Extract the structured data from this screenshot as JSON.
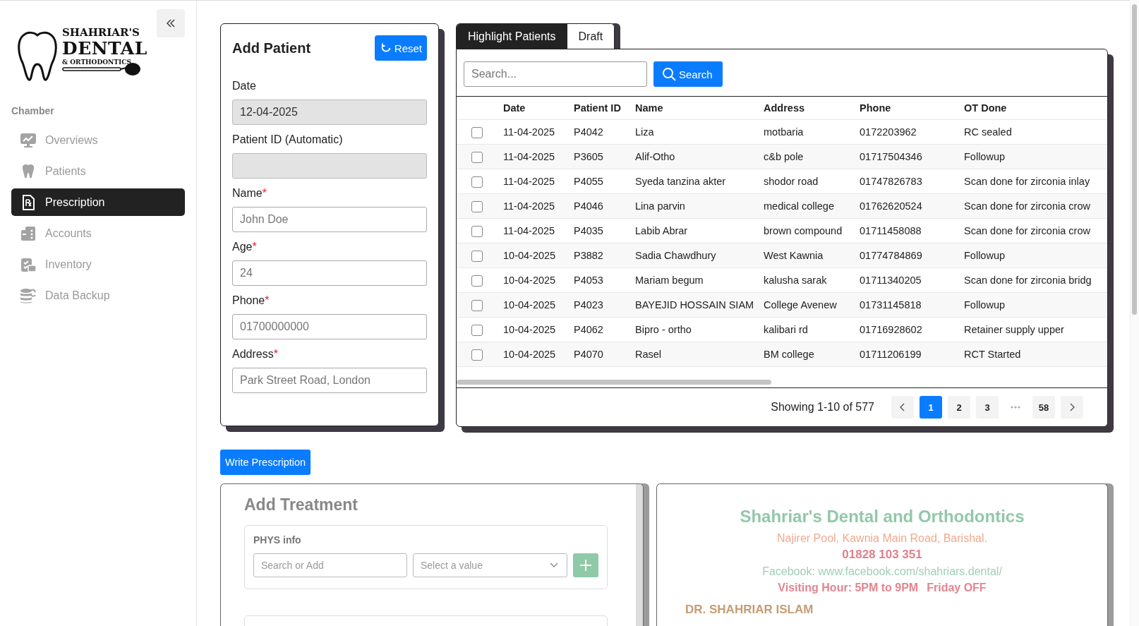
{
  "sidebar": {
    "logo": [
      "SHAHRIAR'S",
      "DENTAL",
      "& ORTHODONTICS"
    ],
    "section": "Chamber",
    "items": [
      {
        "label": "Overviews",
        "selected": false
      },
      {
        "label": "Patients",
        "selected": false
      },
      {
        "label": "Prescription",
        "selected": true
      },
      {
        "label": "Accounts",
        "selected": false
      },
      {
        "label": "Inventory",
        "selected": false
      },
      {
        "label": "Data Backup",
        "selected": false
      }
    ]
  },
  "add_patient": {
    "title": "Add Patient",
    "reset": "Reset",
    "fields": [
      {
        "label": "Date",
        "value": "12-04-2025",
        "disabled": true
      },
      {
        "label": "Patient ID (Automatic)",
        "disabled": true
      },
      {
        "label": "Name",
        "required_mark": "*",
        "placeholder": "John Doe",
        "disabled": false
      },
      {
        "label": "Age",
        "required_mark": "*",
        "placeholder": "24",
        "disabled": false
      },
      {
        "label": "Phone",
        "required_mark": "*",
        "placeholder": "01700000000",
        "disabled": false
      },
      {
        "label": "Address",
        "required_mark": "*",
        "placeholder": "Park Street Road, London",
        "disabled": false
      }
    ]
  },
  "tabs": [
    {
      "label": "Highlight Patients",
      "selected": true
    },
    {
      "label": "Draft",
      "selected": false
    }
  ],
  "search": {
    "placeholder": "Search...",
    "button": "Search"
  },
  "table": {
    "columns": [
      "Date",
      "Patient ID",
      "Name",
      "Address",
      "Phone",
      "OT Done"
    ],
    "rows": [
      {
        "checked": false,
        "cells": [
          "11-04-2025",
          "P4042",
          "Liza",
          "motbaria",
          "0172203962",
          "RC sealed"
        ]
      },
      {
        "checked": false,
        "cells": [
          "11-04-2025",
          "P3605",
          "Alif-Otho",
          "c&b pole",
          "01717504346",
          "Followup"
        ]
      },
      {
        "checked": false,
        "cells": [
          "11-04-2025",
          "P4055",
          "Syeda tanzina akter",
          "shodor road",
          "01747826783",
          "Scan done for zirconia inlay"
        ]
      },
      {
        "checked": false,
        "cells": [
          "11-04-2025",
          "P4046",
          "Lina parvin",
          "medical college",
          "01762620524",
          "Scan done for zirconia crow"
        ]
      },
      {
        "checked": false,
        "cells": [
          "11-04-2025",
          "P4035",
          "Labib Abrar",
          "brown compound",
          "01711458088",
          "Scan done for zirconia crow"
        ]
      },
      {
        "checked": false,
        "cells": [
          "10-04-2025",
          "P3882",
          "Sadia Chawdhury",
          "West Kawnia",
          "01774784869",
          "Followup"
        ]
      },
      {
        "checked": false,
        "cells": [
          "10-04-2025",
          "P4053",
          "Mariam begum",
          "kalusha sarak",
          "01711340205",
          "Scan done for zirconia bridg"
        ]
      },
      {
        "checked": false,
        "cells": [
          "10-04-2025",
          "P4023",
          "BAYEJID HOSSAIN SIAM",
          "College Avenew",
          "01731145818",
          "Followup"
        ]
      },
      {
        "checked": false,
        "cells": [
          "10-04-2025",
          "P4062",
          "Bipro - ortho",
          "kalibari rd",
          "01716928602",
          "Retainer supply upper"
        ]
      },
      {
        "checked": false,
        "cells": [
          "10-04-2025",
          "P4070",
          "Rasel",
          "BM college",
          "01711206199",
          "RCT Started"
        ]
      }
    ]
  },
  "pagination": {
    "summary": "Showing 1-10 of 577",
    "items": [
      {
        "kind": "prev"
      },
      {
        "kind": "page",
        "label": "1",
        "selected": true
      },
      {
        "kind": "page",
        "label": "2",
        "selected": false
      },
      {
        "kind": "page",
        "label": "3",
        "selected": false
      },
      {
        "kind": "ellipsis"
      },
      {
        "kind": "page",
        "label": "58",
        "selected": false
      },
      {
        "kind": "next"
      }
    ]
  },
  "write_prescription": "Write Prescription",
  "treatment": {
    "title": "Add Treatment",
    "group": {
      "title": "PHYS info",
      "search_placeholder": "Search or Add",
      "select_placeholder": "Select a value"
    }
  },
  "letterhead": {
    "clinic": "Shahriar's Dental and Orthodontics",
    "address": "Najirer Pool, Kawnia Main Road, Barishal.",
    "phone": "01828 103 351",
    "facebook": "Facebook: www.facebook.com/shahriars.dental/",
    "hours": "Visiting Hour: 5PM to 9PM",
    "off_day": "Friday OFF",
    "doctor": "DR. SHAHRIAR ISLAM"
  }
}
